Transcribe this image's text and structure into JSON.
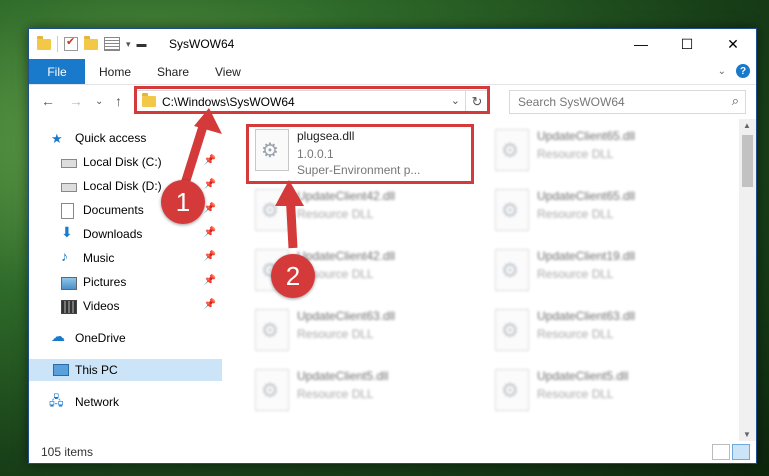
{
  "window": {
    "title": "SysWOW64",
    "controls": [
      "minimize",
      "maximize",
      "close"
    ]
  },
  "ribbon": {
    "file": "File",
    "tabs": [
      "Home",
      "Share",
      "View"
    ]
  },
  "address": {
    "path": "C:\\Windows\\SysWOW64",
    "search_placeholder": "Search SysWOW64"
  },
  "sidebar": {
    "items": [
      {
        "label": "Quick access",
        "icon": "star-icon"
      },
      {
        "label": "Local Disk (C:)",
        "icon": "drive-icon",
        "pinned": true
      },
      {
        "label": "Local Disk (D:)",
        "icon": "drive-icon",
        "pinned": true
      },
      {
        "label": "Documents",
        "icon": "documents-icon",
        "pinned": true
      },
      {
        "label": "Downloads",
        "icon": "download-icon",
        "pinned": true
      },
      {
        "label": "Music",
        "icon": "music-icon",
        "pinned": true
      },
      {
        "label": "Pictures",
        "icon": "pictures-icon",
        "pinned": true
      },
      {
        "label": "Videos",
        "icon": "videos-icon",
        "pinned": true
      },
      {
        "label": "OneDrive",
        "icon": "cloud-icon"
      },
      {
        "label": "This PC",
        "icon": "computer-icon",
        "selected": true
      },
      {
        "label": "Network",
        "icon": "network-icon"
      }
    ]
  },
  "files": {
    "highlighted": {
      "name": "plugsea.dll",
      "version": "1.0.0.1",
      "description": "Super-Environment p..."
    },
    "blurred": [
      {
        "name": "UpdateClient65.dll",
        "type": "Resource DLL"
      },
      {
        "name": "UpdateClient42.dll",
        "type": "Resource DLL"
      },
      {
        "name": "UpdateClient65.dll",
        "type": "Resource DLL"
      },
      {
        "name": "UpdateClient42.dll",
        "type": "Resource DLL"
      },
      {
        "name": "UpdateClient19.dll",
        "type": "Resource DLL"
      },
      {
        "name": "UpdateClient63.dll",
        "type": "Resource DLL"
      },
      {
        "name": "UpdateClient63.dll",
        "type": "Resource DLL"
      },
      {
        "name": "UpdateClient5.dll",
        "type": "Resource DLL"
      },
      {
        "name": "UpdateClient5.dll",
        "type": "Resource DLL"
      }
    ]
  },
  "status": {
    "item_count": "105 items"
  },
  "annotations": {
    "badge1": "1",
    "badge2": "2",
    "color": "#d43a3a"
  }
}
